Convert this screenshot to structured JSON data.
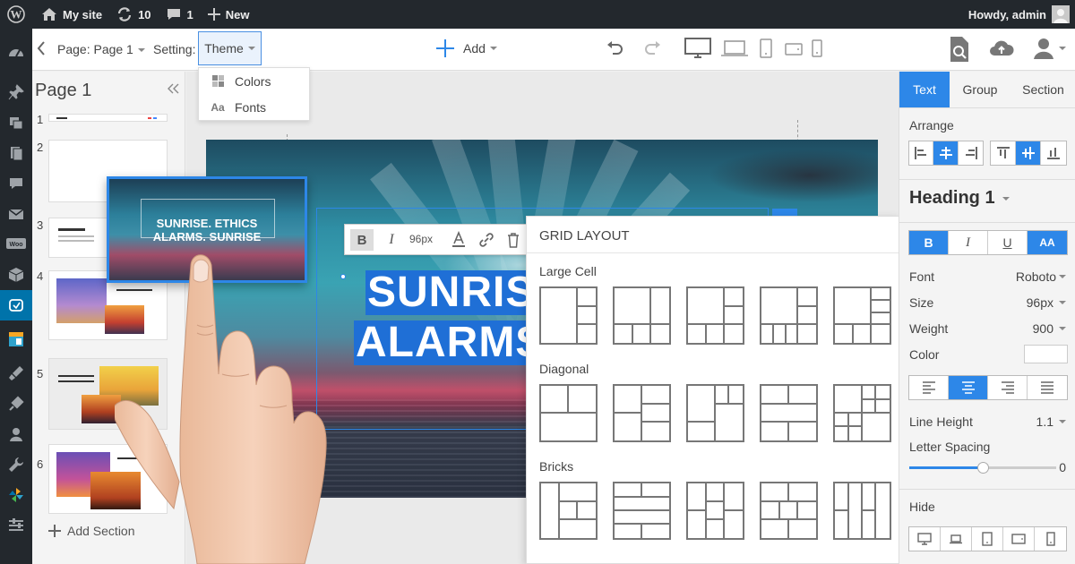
{
  "adminbar": {
    "site_name": "My site",
    "updates_count": "10",
    "comments_count": "1",
    "new_label": "New",
    "howdy": "Howdy, admin"
  },
  "toolbar": {
    "page_label": "Page: Page 1",
    "settings_label": "Setting:",
    "theme_label": "Theme",
    "add_label": "Add"
  },
  "theme_menu": {
    "items": [
      {
        "label": "Colors",
        "icon": "grid-icon"
      },
      {
        "label": "Fonts",
        "icon_text": "Aa"
      }
    ]
  },
  "pages_panel": {
    "title": "Page 1",
    "numbers": [
      "1",
      "2",
      "3",
      "4",
      "5",
      "6"
    ],
    "add_section": "Add Section"
  },
  "canvas": {
    "heading_lines": [
      "SUNRISE",
      "ALARMS"
    ],
    "text_toolbar": {
      "bold": "B",
      "italic": "I",
      "size": "96px"
    }
  },
  "drag_card": {
    "line1": "SUNRISE. ETHICS",
    "line2": "ALARMS. SUNRISE"
  },
  "grid_panel": {
    "title": "Grid Layout",
    "sections": [
      "Large Cell",
      "Diagonal",
      "Bricks"
    ]
  },
  "right_panel": {
    "tabs": [
      "Text",
      "Group",
      "Section"
    ],
    "arrange_label": "Arrange",
    "style_name": "Heading 1",
    "format_buttons": [
      "B",
      "I",
      "U",
      "AA"
    ],
    "font_label": "Font",
    "font_value": "Roboto",
    "size_label": "Size",
    "size_value": "96px",
    "weight_label": "Weight",
    "weight_value": "900",
    "color_label": "Color",
    "line_height_label": "Line Height",
    "line_height_value": "1.1",
    "letter_spacing_label": "Letter Spacing",
    "letter_spacing_value": "0",
    "letter_spacing_level": 0.5,
    "hide_label": "Hide"
  },
  "colors": {
    "accent": "#2d87e8",
    "admin_bar": "#23282d",
    "admin_active": "#0073aa"
  }
}
